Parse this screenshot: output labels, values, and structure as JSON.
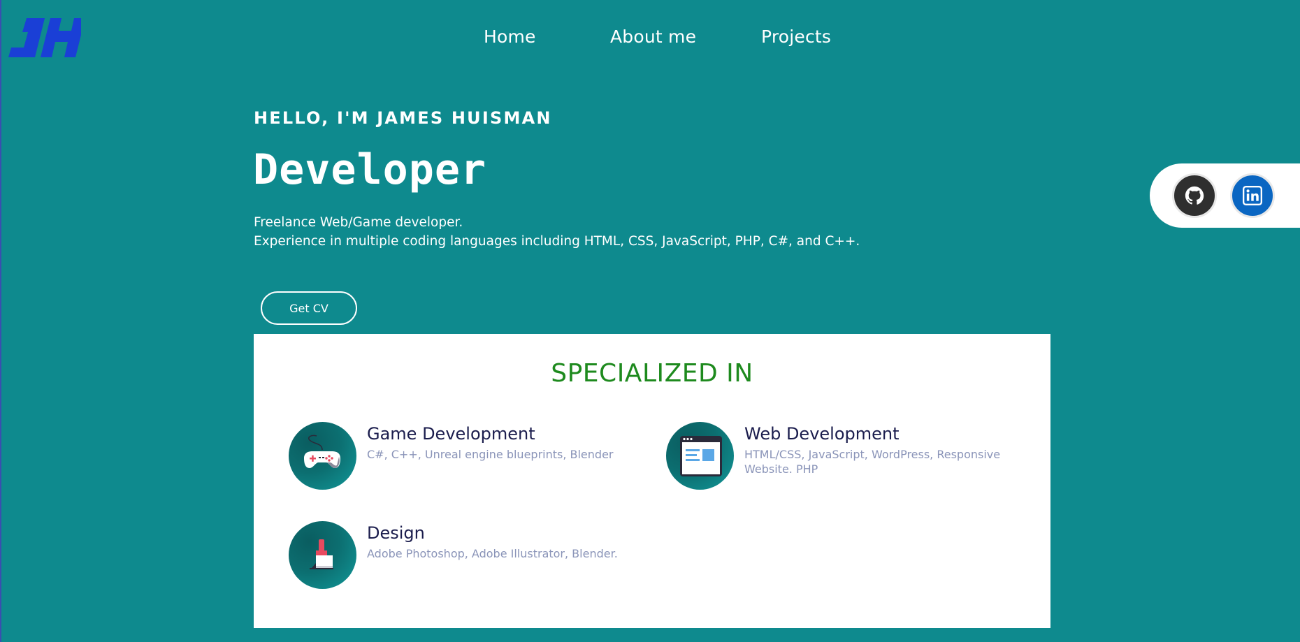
{
  "nav": {
    "home": "Home",
    "about": "About me",
    "projects": "Projects"
  },
  "hero": {
    "greeting": "HELLO, I'M JAMES HUISMAN",
    "role": "Developer",
    "description_line1": "Freelance Web/Game developer.",
    "description_line2": "Experience in multiple coding languages including HTML, CSS, JavaScript, PHP, C#, and C++.",
    "cv_button": "Get CV"
  },
  "social": {
    "github_icon": "github-icon",
    "linkedin_icon": "linkedin-icon"
  },
  "specialized": {
    "title": "SPECIALIZED IN",
    "items": [
      {
        "title": "Game Development",
        "desc": "C#, C++, Unreal engine blueprints, Blender",
        "icon": "gamepad-icon"
      },
      {
        "title": "Web Development",
        "desc": "HTML/CSS, JavaScript, WordPress, Responsive Website. PHP",
        "icon": "browser-window-icon"
      },
      {
        "title": "Design",
        "desc": "Adobe Photoshop, Adobe Illustrator, Blender.",
        "icon": "paint-brush-icon"
      }
    ]
  },
  "colors": {
    "background": "#0e8a8e",
    "panel": "#ffffff",
    "title_green": "#1e8a1e",
    "skill_title": "#1b1d4d",
    "skill_desc": "#8a94b8",
    "logo_blue": "#1a3fd6"
  }
}
